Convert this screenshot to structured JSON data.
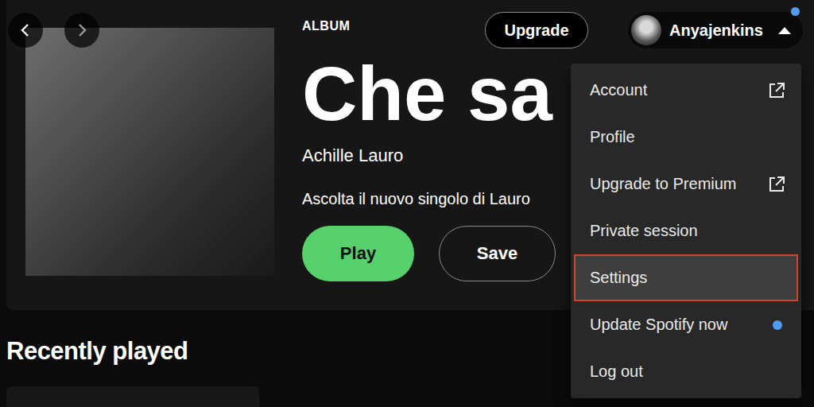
{
  "header": {
    "upgrade": "Upgrade",
    "user": {
      "name": "Anyajenkins",
      "notification": true,
      "menu_open": true
    }
  },
  "album": {
    "type_label": "ALBUM",
    "title": "Che sa",
    "artist": "Achille Lauro",
    "description": "Ascolta il nuovo singolo di Lauro",
    "buttons": [
      {
        "label": "Play",
        "kind": "primary"
      },
      {
        "label": "Save",
        "kind": "outline"
      }
    ]
  },
  "menu": {
    "items": [
      {
        "label": "Account",
        "external": true,
        "badge": false,
        "selected": false
      },
      {
        "label": "Profile",
        "external": false,
        "badge": false,
        "selected": false
      },
      {
        "label": "Upgrade to Premium",
        "external": true,
        "badge": false,
        "selected": false
      },
      {
        "label": "Private session",
        "external": false,
        "badge": false,
        "selected": false
      },
      {
        "label": "Settings",
        "external": false,
        "badge": false,
        "selected": true
      },
      {
        "label": "Update Spotify now",
        "external": false,
        "badge": true,
        "selected": false
      },
      {
        "label": "Log out",
        "external": false,
        "badge": false,
        "selected": false
      }
    ]
  },
  "section": {
    "title": "Recently played"
  }
}
